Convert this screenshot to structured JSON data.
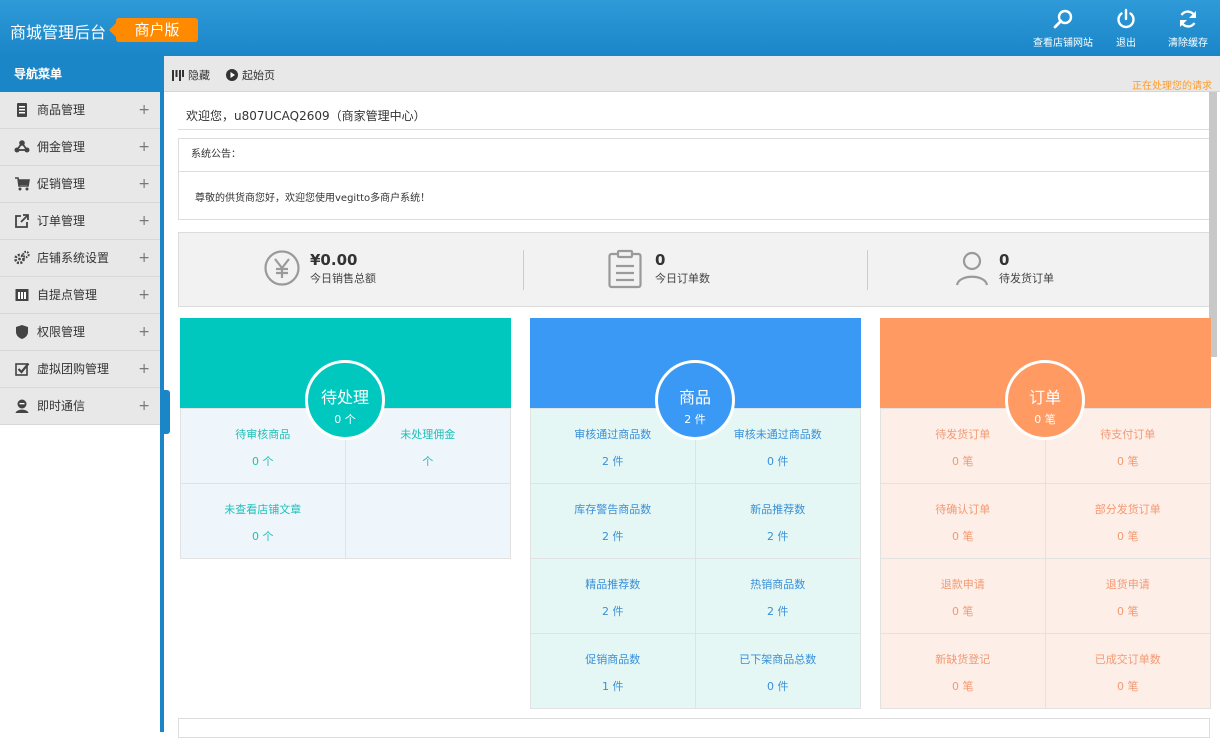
{
  "header": {
    "title": "商城管理后台",
    "badge": "商户版",
    "buttons": [
      {
        "label": "查看店铺网站",
        "icon": "search-icon"
      },
      {
        "label": "退出",
        "icon": "power-icon"
      },
      {
        "label": "清除缓存",
        "icon": "refresh-icon"
      }
    ]
  },
  "sidebar": {
    "title": "导航菜单",
    "items": [
      {
        "label": "商品管理",
        "icon": "product-icon"
      },
      {
        "label": "佣金管理",
        "icon": "share-icon"
      },
      {
        "label": "促销管理",
        "icon": "cart-icon"
      },
      {
        "label": "订单管理",
        "icon": "external-link-icon"
      },
      {
        "label": "店铺系统设置",
        "icon": "gears-icon"
      },
      {
        "label": "自提点管理",
        "icon": "store-icon"
      },
      {
        "label": "权限管理",
        "icon": "shield-icon"
      },
      {
        "label": "虚拟团购管理",
        "icon": "checkbox-icon"
      },
      {
        "label": "即时通信",
        "icon": "chat-user-icon"
      }
    ],
    "expand_symbol": "+"
  },
  "toolbar": {
    "hide_label": "隐藏",
    "home_label": "起始页",
    "processing": "正在处理您的请求"
  },
  "welcome": "欢迎您，u807UCAQ2609（商家管理中心）",
  "notice": {
    "title": "系统公告：",
    "body": "尊敬的供货商您好，欢迎您使用vegitto多商户系统！"
  },
  "stats": [
    {
      "value": "¥0.00",
      "label": "今日销售总额",
      "icon": "yen-icon"
    },
    {
      "value": "0",
      "label": "今日订单数",
      "icon": "clipboard-icon"
    },
    {
      "value": "0",
      "label": "待发货订单",
      "icon": "user-icon"
    }
  ],
  "cards": [
    {
      "title": "待处理",
      "count": "0 个",
      "color": "#00c8bf",
      "bg": "#eef6fc",
      "text_color": "#1fbfb6",
      "cells": [
        {
          "label": "待审核商品",
          "value": "0 个"
        },
        {
          "label": "未处理佣金",
          "value": "个"
        },
        {
          "label": "未查看店铺文章",
          "value": "0 个"
        },
        {
          "label": "",
          "value": ""
        }
      ]
    },
    {
      "title": "商品",
      "count": "2 件",
      "color": "#3a99f5",
      "bg": "#e4f7f5",
      "text_color": "#3a8fd8",
      "cells": [
        {
          "label": "审核通过商品数",
          "value": "2 件"
        },
        {
          "label": "审核未通过商品数",
          "value": "0 件"
        },
        {
          "label": "库存警告商品数",
          "value": "2 件"
        },
        {
          "label": "新品推荐数",
          "value": "2 件"
        },
        {
          "label": "精品推荐数",
          "value": "2 件"
        },
        {
          "label": "热销商品数",
          "value": "2 件"
        },
        {
          "label": "促销商品数",
          "value": "1 件"
        },
        {
          "label": "已下架商品总数",
          "value": "0 件"
        }
      ]
    },
    {
      "title": "订单",
      "count": "0 笔",
      "color": "#ff9a63",
      "bg": "#fdeee8",
      "text_color": "#f29a73",
      "cells": [
        {
          "label": "待发货订单",
          "value": "0 笔"
        },
        {
          "label": "待支付订单",
          "value": "0 笔"
        },
        {
          "label": "待确认订单",
          "value": "0 笔"
        },
        {
          "label": "部分发货订单",
          "value": "0 笔"
        },
        {
          "label": "退款申请",
          "value": "0 笔"
        },
        {
          "label": "退货申请",
          "value": "0 笔"
        },
        {
          "label": "新缺货登记",
          "value": "0 笔"
        },
        {
          "label": "已成交订单数",
          "value": "0 笔"
        }
      ]
    }
  ]
}
